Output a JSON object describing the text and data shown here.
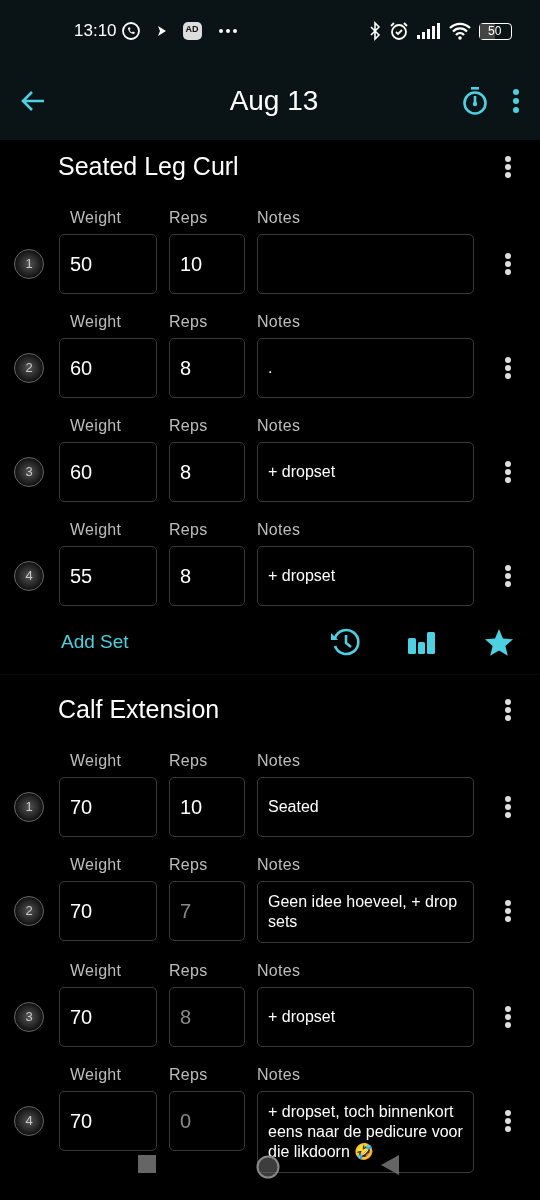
{
  "status_bar": {
    "time": "13:10",
    "ad_badge": "AD",
    "battery": "50"
  },
  "header": {
    "title": "Aug 13"
  },
  "exercises": [
    {
      "name": "Seated Leg Curl",
      "add_set": "Add Set",
      "sets": [
        {
          "number": "1",
          "weight": {
            "label": "Weight",
            "value": "50"
          },
          "reps": {
            "label": "Reps",
            "value": "10"
          },
          "notes": {
            "label": "Notes"
          }
        },
        {
          "number": "2",
          "weight": {
            "label": "Weight",
            "value": "60"
          },
          "reps": {
            "label": "Reps",
            "value": "8"
          },
          "notes": {
            "label": "Notes",
            "value": "."
          }
        },
        {
          "number": "3",
          "weight": {
            "label": "Weight",
            "value": "60"
          },
          "reps": {
            "label": "Reps",
            "value": "8"
          },
          "notes": {
            "label": "Notes",
            "value": "+ dropset"
          }
        },
        {
          "number": "4",
          "weight": {
            "label": "Weight",
            "value": "55"
          },
          "reps": {
            "label": "Reps",
            "value": "8"
          },
          "notes": {
            "label": "Notes",
            "value": "+ dropset"
          }
        }
      ]
    },
    {
      "name": "Calf Extension",
      "sets": [
        {
          "number": "1",
          "weight": {
            "label": "Weight",
            "value": "70"
          },
          "reps": {
            "label": "Reps",
            "value": "10"
          },
          "notes": {
            "label": "Notes",
            "value": "Seated"
          }
        },
        {
          "number": "2",
          "weight": {
            "label": "Weight",
            "value": "70"
          },
          "reps": {
            "label": "Reps",
            "placeholder": "7"
          },
          "notes": {
            "label": "Notes",
            "value": "Geen idee hoeveel, + drop sets"
          }
        },
        {
          "number": "3",
          "weight": {
            "label": "Weight",
            "value": "70"
          },
          "reps": {
            "label": "Reps",
            "placeholder": "8"
          },
          "notes": {
            "label": "Notes",
            "value": "+ dropset"
          }
        },
        {
          "number": "4",
          "weight": {
            "label": "Weight",
            "value": "70"
          },
          "reps": {
            "label": "Reps",
            "placeholder": "0"
          },
          "notes": {
            "label": "Notes",
            "value": "+ dropset, toch binnenkort eens naar de pedicure voor die likdoorn 🤣"
          }
        }
      ]
    }
  ]
}
